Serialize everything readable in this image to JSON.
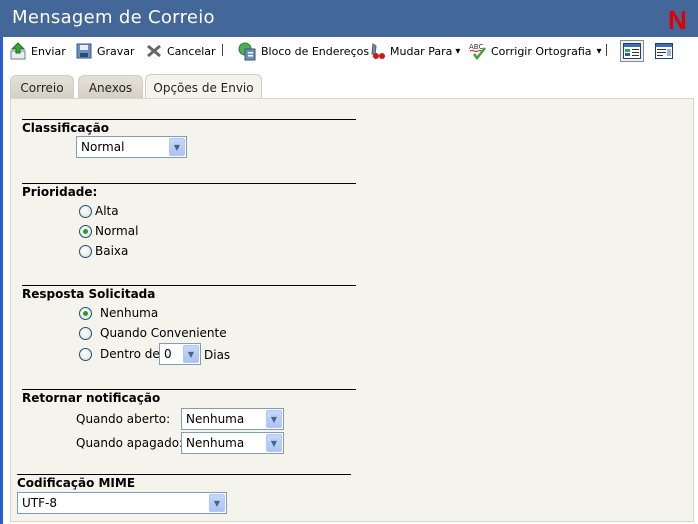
{
  "window": {
    "title": "Mensagem de Correio",
    "logo": "N",
    "logo_color": "#e00000",
    "titlebar_color": "#436799"
  },
  "toolbar": {
    "send": {
      "label": "Enviar",
      "icon": "send-icon"
    },
    "save": {
      "label": "Gravar",
      "icon": "floppy-disk-icon"
    },
    "cancel": {
      "label": "Cancelar",
      "icon": "close-x-icon"
    },
    "address_book": {
      "label": "Bloco de Endereços",
      "icon": "address-book-icon"
    },
    "switch_to": {
      "label": "Mudar Para",
      "icon": "switch-icon"
    },
    "spellcheck": {
      "label": "Corrigir Ortografia",
      "icon": "spellcheck-icon"
    },
    "dropdown_glyph": "▾"
  },
  "tabs": [
    {
      "label": "Correio",
      "active": false
    },
    {
      "label": "Anexos",
      "active": false
    },
    {
      "label": "Opções de Envio",
      "active": true
    }
  ],
  "classification": {
    "title": "Classificação",
    "value": "Normal"
  },
  "priority": {
    "title": "Prioridade:",
    "options": [
      {
        "label": "Alta",
        "checked": false
      },
      {
        "label": "Normal",
        "checked": true
      },
      {
        "label": "Baixa",
        "checked": false
      }
    ]
  },
  "reply": {
    "title": "Resposta Solicitada",
    "options": [
      {
        "label": "Nenhuma",
        "checked": true
      },
      {
        "label": "Quando Conveniente",
        "checked": false
      },
      {
        "label": "Dentro de",
        "checked": false
      }
    ],
    "days_value": "0",
    "days_label": "Dias"
  },
  "notification": {
    "title": "Retornar notificação",
    "opened_label": "Quando aberto:",
    "opened_value": "Nenhuma",
    "deleted_label": "Quando apagado:",
    "deleted_value": "Nenhuma"
  },
  "mime": {
    "title": "Codificação MIME",
    "value": "UTF-8"
  },
  "select_arrow": "▼"
}
